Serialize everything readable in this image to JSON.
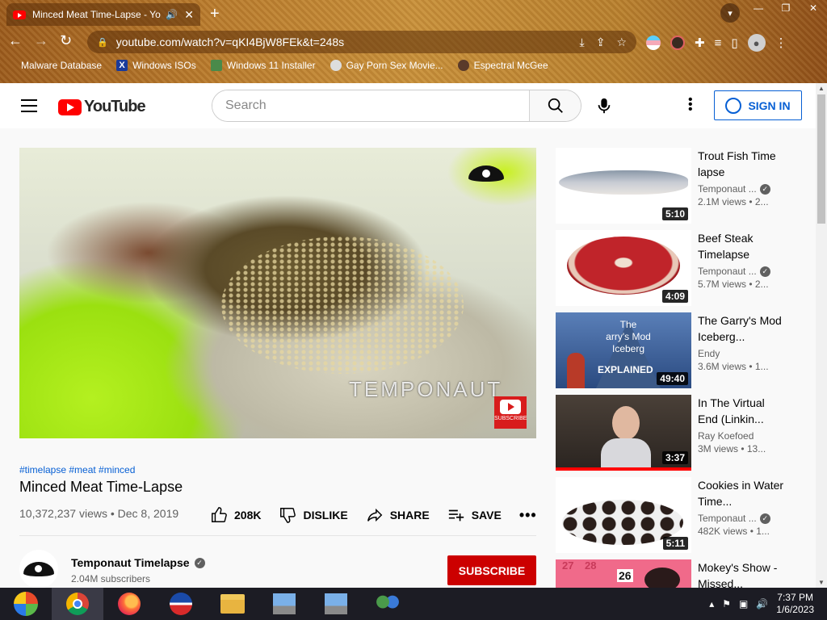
{
  "browser": {
    "tab_title": "Minced Meat Time-Lapse - Yo",
    "new_tab": "+",
    "url": "youtube.com/watch?v=qKI4BjW8FEk&t=248s",
    "window_controls": [
      "—",
      "❐",
      "✕"
    ],
    "bookmarks": [
      {
        "label": "Malware Database",
        "icon": "malware-db-icon"
      },
      {
        "label": "Windows ISOs",
        "icon": "x-icon"
      },
      {
        "label": "Windows 11 Installer",
        "icon": "installer-icon"
      },
      {
        "label": "Gay Porn Sex Movie...",
        "icon": "site-icon"
      },
      {
        "label": "Espectral McGee",
        "icon": "avatar-icon"
      }
    ]
  },
  "masthead": {
    "logo_text": "YouTube",
    "search_placeholder": "Search",
    "signin_label": "SIGN IN"
  },
  "video": {
    "watermark": "TEMPONAUT",
    "subscribe_badge": "SUBSCRIBE",
    "tags": "#timelapse #meat #minced",
    "title": "Minced Meat Time-Lapse",
    "views_date": "10,372,237 views • Dec 8, 2019",
    "likes": "208K",
    "dislike_label": "DISLIKE",
    "share_label": "SHARE",
    "save_label": "SAVE"
  },
  "channel": {
    "name": "Temponaut Timelapse",
    "subscribers": "2.04M subscribers",
    "subscribe_label": "SUBSCRIBE"
  },
  "recommendations": [
    {
      "title": "Trout Fish Time lapse",
      "channel": "Temponaut ...",
      "verified": true,
      "views": "2.1M views • 2...",
      "duration": "5:10"
    },
    {
      "title": "Beef Steak Timelapse",
      "channel": "Temponaut ...",
      "verified": true,
      "views": "5.7M views • 2...",
      "duration": "4:09"
    },
    {
      "title": "The Garry's Mod Iceberg...",
      "channel": "Endy",
      "verified": false,
      "views": "3.6M views • 1...",
      "duration": "49:40",
      "thumb_text_1": "The",
      "thumb_text_2": "arry's Mod",
      "thumb_text_3": "Iceberg",
      "thumb_text_4": "EXPLAINED"
    },
    {
      "title": "In The Virtual End (Linkin...",
      "channel": "Ray Koefoed",
      "verified": false,
      "views": "3M views • 13...",
      "duration": "3:37",
      "watched": true
    },
    {
      "title": "Cookies in Water Time...",
      "channel": "Temponaut ...",
      "verified": true,
      "views": "482K views • 1...",
      "duration": "5:11"
    },
    {
      "title": "Mokey's Show - Missed...",
      "thumb_text_1": "27",
      "thumb_text_2": "28",
      "thumb_text_3": "26"
    }
  ],
  "taskbar": {
    "time": "7:37 PM",
    "date": "1/6/2023"
  }
}
